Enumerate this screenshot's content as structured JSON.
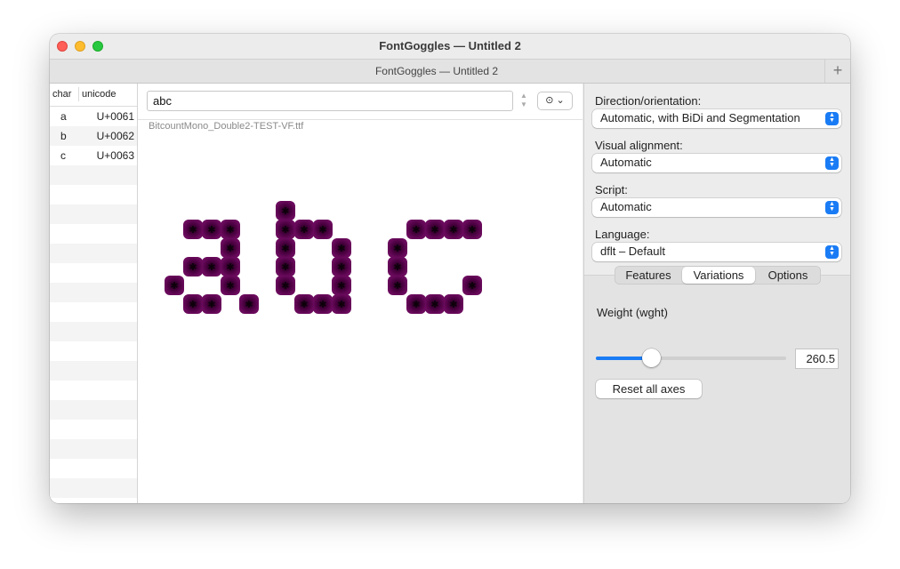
{
  "window": {
    "title": "FontGoggles — Untitled 2",
    "tab_title": "FontGoggles — Untitled 2",
    "tab_add": "+"
  },
  "char_list": {
    "headers": {
      "char": "char",
      "unicode": "unicode"
    },
    "rows": [
      {
        "char": "a",
        "unicode": "U+0061"
      },
      {
        "char": "b",
        "unicode": "U+0062"
      },
      {
        "char": "c",
        "unicode": "U+0063"
      }
    ],
    "empty_rows": 17
  },
  "center": {
    "text_input_value": "abc",
    "more_button": "⊙ ⌄",
    "font_file": "BitcountMono_Double2-TEST-VF.ttf",
    "glyph_color": "#4a0040",
    "glyph_dark": "#1a0015",
    "rendered_text": "abc"
  },
  "right_panel": {
    "direction": {
      "label": "Direction/orientation:",
      "value": "Automatic, with BiDi and Segmentation"
    },
    "visual_alignment": {
      "label": "Visual alignment:",
      "value": "Automatic"
    },
    "script": {
      "label": "Script:",
      "value": "Automatic"
    },
    "language": {
      "label": "Language:",
      "value": "dflt – Default"
    },
    "tabs": [
      "Features",
      "Variations",
      "Options"
    ],
    "active_tab": "Variations",
    "axis": {
      "label": "Weight (wght)",
      "value": "260.5",
      "fraction": 0.29
    },
    "reset_button": "Reset all axes",
    "accent_color": "#1a7cf5"
  }
}
